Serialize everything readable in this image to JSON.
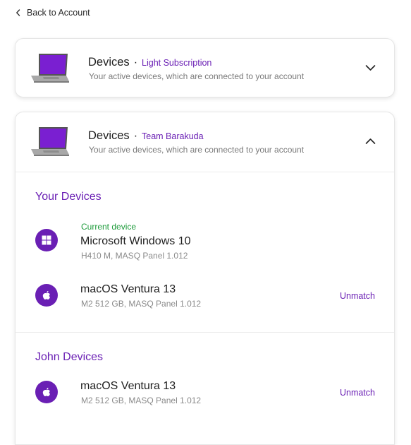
{
  "nav": {
    "back_label": "Back to Account"
  },
  "colors": {
    "accent": "#6a1fb4",
    "current": "#1e9b3b"
  },
  "cards": [
    {
      "title": "Devices",
      "separator": "·",
      "plan": "Light Subscription",
      "subtitle": "Your active devices, which are connected to your account",
      "expanded": false
    },
    {
      "title": "Devices",
      "separator": "·",
      "plan": "Team Barakuda",
      "subtitle": "Your active devices, which are connected to your account",
      "expanded": true,
      "sections": [
        {
          "title": "Your Devices",
          "devices": [
            {
              "badge": "Current device",
              "icon": "windows-icon",
              "name": "Microsoft Windows 10",
              "spec": "H410 M, MASQ Panel 1.012",
              "action": ""
            },
            {
              "badge": "",
              "icon": "apple-icon",
              "name": "macOS Ventura 13",
              "spec": "M2 512 GB, MASQ Panel 1.012",
              "action": "Unmatch"
            }
          ]
        },
        {
          "title": "John Devices",
          "devices": [
            {
              "badge": "",
              "icon": "apple-icon",
              "name": "macOS Ventura 13",
              "spec": "M2 512 GB, MASQ Panel 1.012",
              "action": "Unmatch"
            }
          ]
        }
      ]
    }
  ]
}
